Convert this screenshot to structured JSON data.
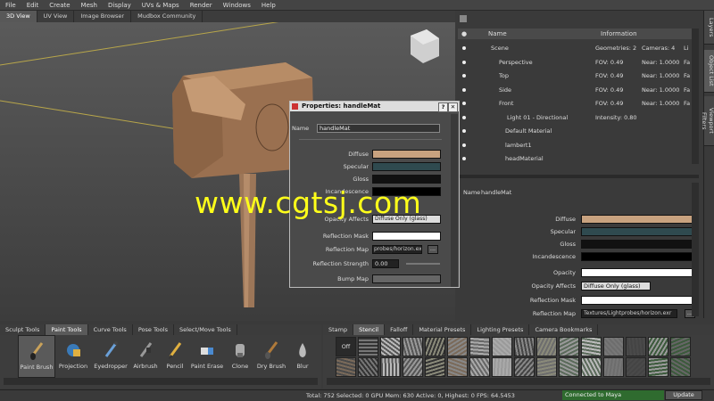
{
  "menubar": [
    "File",
    "Edit",
    "Create",
    "Mesh",
    "Display",
    "UVs & Maps",
    "Render",
    "Windows",
    "Help"
  ],
  "viewport_tabs": [
    "3D View",
    "UV View",
    "Image Browser",
    "Mudbox Community"
  ],
  "side_tabs": [
    "Layers",
    "Object List",
    "Viewport Filters"
  ],
  "object_list": {
    "headers": {
      "name": "Name",
      "info": "Information"
    },
    "rows": [
      {
        "name": "Scene",
        "c2": "Geometries: 2",
        "c3": "Cameras: 4",
        "c4": "Li"
      },
      {
        "name": "Perspective",
        "c2": "FOV: 0.49",
        "c3": "Near: 1.0000",
        "c4": "Fa"
      },
      {
        "name": "Top",
        "c2": "FOV: 0.49",
        "c3": "Near: 1.0000",
        "c4": "Fa"
      },
      {
        "name": "Side",
        "c2": "FOV: 0.49",
        "c3": "Near: 1.0000",
        "c4": "Fa"
      },
      {
        "name": "Front",
        "c2": "FOV: 0.49",
        "c3": "Near: 1.0000",
        "c4": "Fa"
      },
      {
        "name": "Light 01 - Directional",
        "c2": "Intensity: 0.80",
        "c3": "",
        "c4": ""
      },
      {
        "name": "Default Material",
        "c2": "",
        "c3": "",
        "c4": ""
      },
      {
        "name": "lambert1",
        "c2": "",
        "c3": "",
        "c4": ""
      },
      {
        "name": "headMaterial",
        "c2": "",
        "c3": "",
        "c4": ""
      }
    ]
  },
  "right_props": {
    "name_label": "Name",
    "name_value": "handleMat",
    "diffuse": "Diffuse",
    "specular": "Specular",
    "gloss": "Gloss",
    "incandescence": "Incandescence",
    "opacity": "Opacity",
    "opacity_affects": "Opacity Affects",
    "opacity_affects_value": "Diffuse Only (glass)",
    "reflection_mask": "Reflection Mask",
    "reflection_map": "Reflection Map",
    "reflection_map_value": "Textures/Lightprobes/horizon.exr",
    "browse": "..."
  },
  "dialog": {
    "title": "Properties: handleMat",
    "help_btn": "?",
    "close_btn": "✕",
    "name_label": "Name",
    "name_value": "handleMat",
    "diffuse": "Diffuse",
    "specular": "Specular",
    "gloss": "Gloss",
    "incandescence": "Incandescence",
    "opacity_affects": "Opacity Affects",
    "opacity_affects_value": "Diffuse Only (glass)",
    "reflection_mask": "Reflection Mask",
    "reflection_map": "Reflection Map",
    "reflection_map_value": "probes/horizon.exr",
    "browse": "...",
    "reflection_strength": "Reflection Strength",
    "reflection_strength_value": "0.00",
    "bump_map": "Bump Map"
  },
  "tool_tabs": [
    "Sculpt Tools",
    "Paint Tools",
    "Curve Tools",
    "Pose Tools",
    "Select/Move Tools"
  ],
  "paint_tools": [
    "Paint Brush",
    "Projection",
    "Eyedropper",
    "Airbrush",
    "Pencil",
    "Paint Erase",
    "Clone",
    "Dry Brush",
    "Blur"
  ],
  "stamp_tabs": [
    "Stamp",
    "Stencil",
    "Falloff",
    "Material Presets",
    "Lighting Presets",
    "Camera Bookmarks"
  ],
  "stencil_off": "Off",
  "status": "Total: 752  Selected: 0 GPU Mem: 630  Active: 0, Highest: 0  FPS: 64.5453",
  "connection": "Connected to Maya",
  "update": "Update",
  "watermark": "www.cgtsj.com",
  "colors": {
    "diffuse": "#c8a27f",
    "specular": "#2f4a4f",
    "gloss": "#111111",
    "incandescence": "#000000",
    "opacity": "#ffffff",
    "accent": "#2f6b2f"
  }
}
